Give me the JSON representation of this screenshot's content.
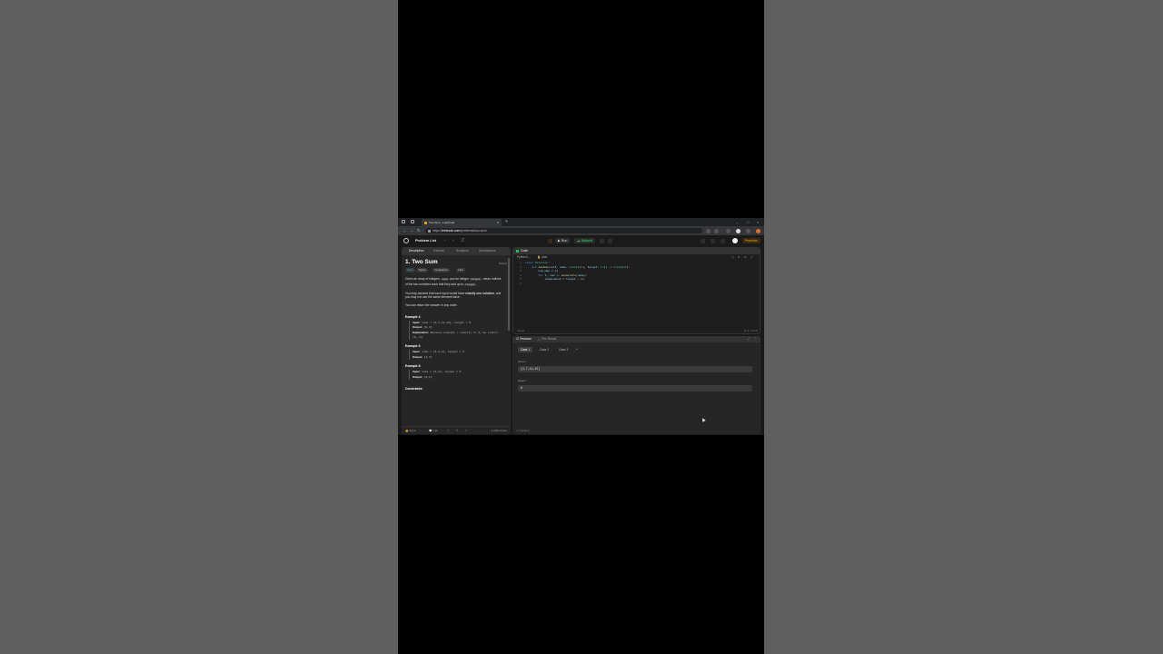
{
  "browser": {
    "tab_title": "Two Sum - LeetCode",
    "close_tab": "×",
    "new_tab": "+",
    "url_host": "leetcode.com",
    "url_prefix": "https://",
    "url_path": "/problems/two-sum/",
    "window_controls": [
      "–",
      "□",
      "×"
    ]
  },
  "header": {
    "problem_list": "Problem List",
    "run": "Run",
    "submit": "Submit",
    "premium": "Premium"
  },
  "left_panel": {
    "tabs": [
      "Description",
      "Editorial",
      "Solutions",
      "Submissions"
    ],
    "title": "1. Two Sum",
    "solved": "Solved",
    "tags": [
      "Easy",
      "Topics",
      "Companies",
      "Hint"
    ],
    "para1_a": "Given an array of integers ",
    "para1_code1": "nums",
    "para1_b": " and an integer ",
    "para1_code2": "target",
    "para1_c": ", return indices of the two numbers such that they add up to ",
    "para1_code3": "target",
    "para1_d": ".",
    "para2_a": "You may assume that each input would have ",
    "para2_bold": "exactly one solution",
    "para2_b": ", and you may not use the same element twice.",
    "para3": "You can return the answer in any order.",
    "examples": [
      {
        "heading": "Example 1:",
        "input": "nums = [2,7,11,15], target = 9",
        "output": "[0,1]",
        "explanation": "Because nums[0] + nums[1] == 9, we return [0, 1]."
      },
      {
        "heading": "Example 2:",
        "input": "nums = [3,2,4], target = 6",
        "output": "[1,2]"
      },
      {
        "heading": "Example 3:",
        "input": "nums = [3,3], target = 6",
        "output": "[0,1]"
      }
    ],
    "input_label": "Input:",
    "output_label": "Output:",
    "explanation_label": "Explanation:",
    "constraints": "Constraints:",
    "footer_likes": "60.1K",
    "footer_comments": "1.3K",
    "footer_online": "1869 Online"
  },
  "code_panel": {
    "title": "Code",
    "language": "Python3",
    "mode": "Auto",
    "line_numbers": [
      "1",
      "2",
      "3",
      "4",
      "5",
      "6"
    ],
    "footer_left": "Saved",
    "footer_right": "Ln 6, Col 34"
  },
  "test_panel": {
    "tabs": [
      "Testcase",
      "Test Result"
    ],
    "cases": [
      "Case 1",
      "Case 2",
      "Case 3"
    ],
    "add_case": "+",
    "nums_label": "nums =",
    "nums_value": "[2,7,11,15]",
    "target_label": "target =",
    "target_value": "9",
    "footer": "Source"
  }
}
